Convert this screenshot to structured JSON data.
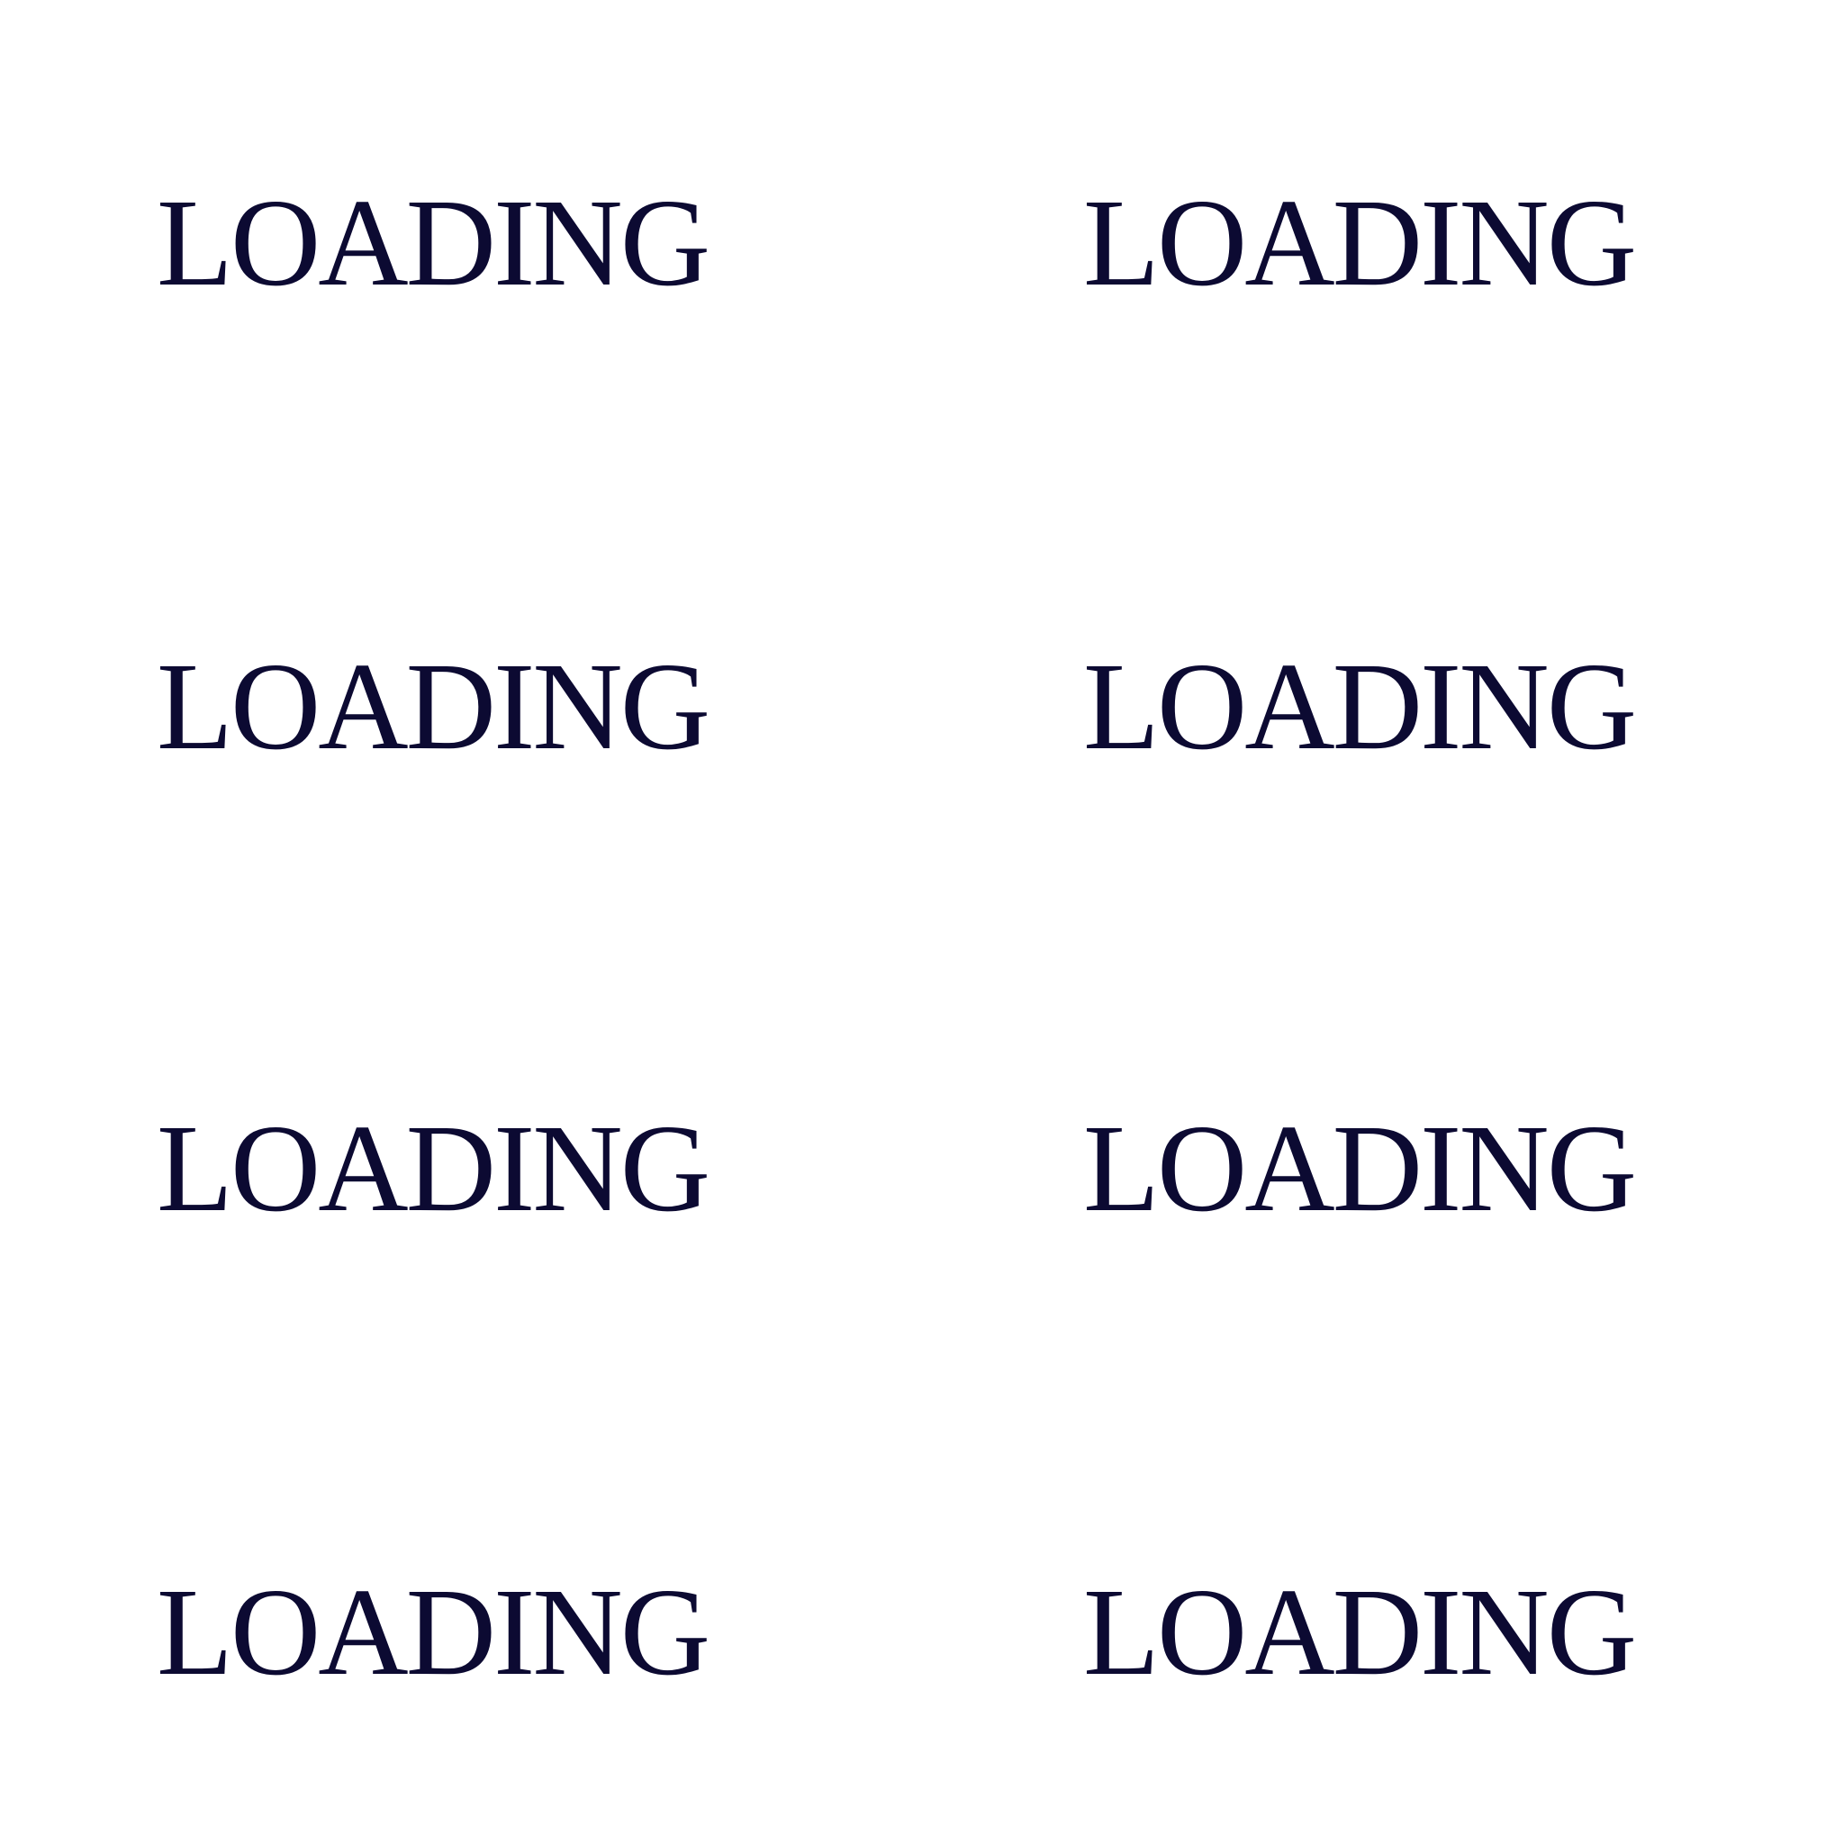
{
  "loading_grid": {
    "items": [
      {
        "label": "LOADING"
      },
      {
        "label": "LOADING"
      },
      {
        "label": "LOADING"
      },
      {
        "label": "LOADING"
      },
      {
        "label": "LOADING"
      },
      {
        "label": "LOADING"
      },
      {
        "label": "LOADING"
      },
      {
        "label": "LOADING"
      }
    ]
  },
  "colors": {
    "background": "#ffffff",
    "text": "#0c0a32"
  }
}
